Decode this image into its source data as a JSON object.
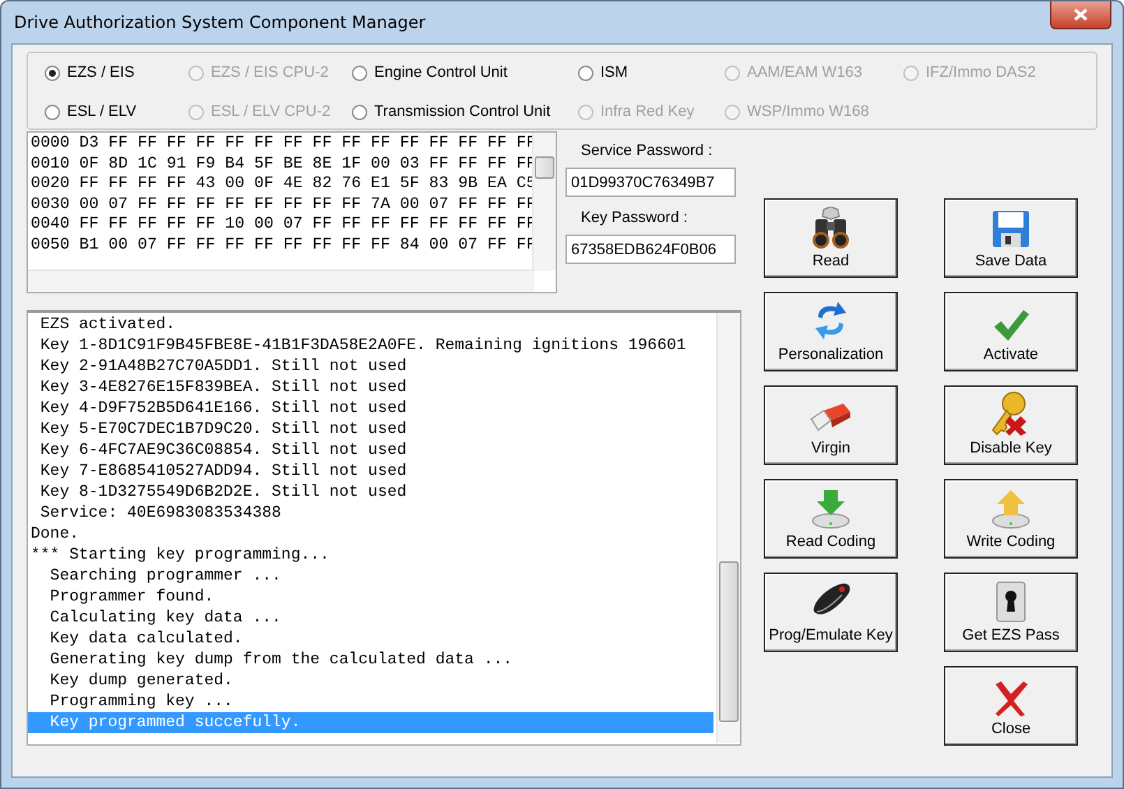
{
  "window": {
    "title": "Drive Authorization System Component Manager"
  },
  "components": [
    {
      "label": "EZS / EIS",
      "selected": true,
      "disabled": false
    },
    {
      "label": "EZS / EIS CPU-2",
      "selected": false,
      "disabled": true
    },
    {
      "label": "Engine Control Unit",
      "selected": false,
      "disabled": false
    },
    {
      "label": "ISM",
      "selected": false,
      "disabled": false
    },
    {
      "label": "AAM/EAM W163",
      "selected": false,
      "disabled": true
    },
    {
      "label": "IFZ/Immo DAS2",
      "selected": false,
      "disabled": true
    },
    {
      "label": "ESL / ELV",
      "selected": false,
      "disabled": false
    },
    {
      "label": "ESL / ELV CPU-2",
      "selected": false,
      "disabled": true
    },
    {
      "label": "Transmission Control Unit",
      "selected": false,
      "disabled": false
    },
    {
      "label": "Infra Red Key",
      "selected": false,
      "disabled": true
    },
    {
      "label": "WSP/Immo W168",
      "selected": false,
      "disabled": true
    }
  ],
  "hex_dump": [
    "0000 D3 FF FF FF FF FF FF FF FF FF FF FF FF FF FF FF",
    "0010 0F 8D 1C 91 F9 B4 5F BE 8E 1F 00 03 FF FF FF FF",
    "0020 FF FF FF FF 43 00 0F 4E 82 76 E1 5F 83 9B EA C5",
    "0030 00 07 FF FF FF FF FF FF FF FF 7A 00 07 FF FF FF",
    "0040 FF FF FF FF FF 10 00 07 FF FF FF FF FF FF FF FF",
    "0050 B1 00 07 FF FF FF FF FF FF FF FF 84 00 07 FF FF"
  ],
  "service_password": {
    "label": "Service Password :",
    "value": "01D99370C76349B7"
  },
  "key_password": {
    "label": "Key Password :",
    "value": "67358EDB624F0B06"
  },
  "log": [
    {
      "text": " EZS activated.",
      "selected": false
    },
    {
      "text": " Key 1-8D1C91F9B45FBE8E-41B1F3DA58E2A0FE. Remaining ignitions 196601",
      "selected": false
    },
    {
      "text": " Key 2-91A48B27C70A5DD1. Still not used",
      "selected": false
    },
    {
      "text": " Key 3-4E8276E15F839BEA. Still not used",
      "selected": false
    },
    {
      "text": " Key 4-D9F752B5D641E166. Still not used",
      "selected": false
    },
    {
      "text": " Key 5-E70C7DEC1B7D9C20. Still not used",
      "selected": false
    },
    {
      "text": " Key 6-4FC7AE9C36C08854. Still not used",
      "selected": false
    },
    {
      "text": " Key 7-E8685410527ADD94. Still not used",
      "selected": false
    },
    {
      "text": " Key 8-1D3275549D6B2D2E. Still not used",
      "selected": false
    },
    {
      "text": " Service: 40E6983083534388",
      "selected": false
    },
    {
      "text": "Done.",
      "selected": false
    },
    {
      "text": "*** Starting key programming...",
      "selected": false
    },
    {
      "text": "  Searching programmer ...",
      "selected": false
    },
    {
      "text": "  Programmer found.",
      "selected": false
    },
    {
      "text": "  Calculating key data ...",
      "selected": false
    },
    {
      "text": "  Key data calculated.",
      "selected": false
    },
    {
      "text": "  Generating key dump from the calculated data ...",
      "selected": false
    },
    {
      "text": "  Key dump generated.",
      "selected": false
    },
    {
      "text": "  Programming key ...",
      "selected": false
    },
    {
      "text": "  Key programmed succefully.",
      "selected": true
    }
  ],
  "buttons": [
    {
      "label": "Read",
      "kind": "binoculars"
    },
    {
      "label": "Save Data",
      "kind": "floppy"
    },
    {
      "label": "Personalization",
      "kind": "sync"
    },
    {
      "label": "Activate",
      "kind": "check"
    },
    {
      "label": "Virgin",
      "kind": "eraser"
    },
    {
      "label": "Disable Key",
      "kind": "keyx"
    },
    {
      "label": "Read Coding",
      "kind": "download"
    },
    {
      "label": "Write Coding",
      "kind": "upload"
    },
    {
      "label": "Prog/Emulate Key",
      "kind": "fob"
    },
    {
      "label": "Get EZS Pass",
      "kind": "lock"
    },
    {
      "label": "Close",
      "kind": "close"
    }
  ]
}
